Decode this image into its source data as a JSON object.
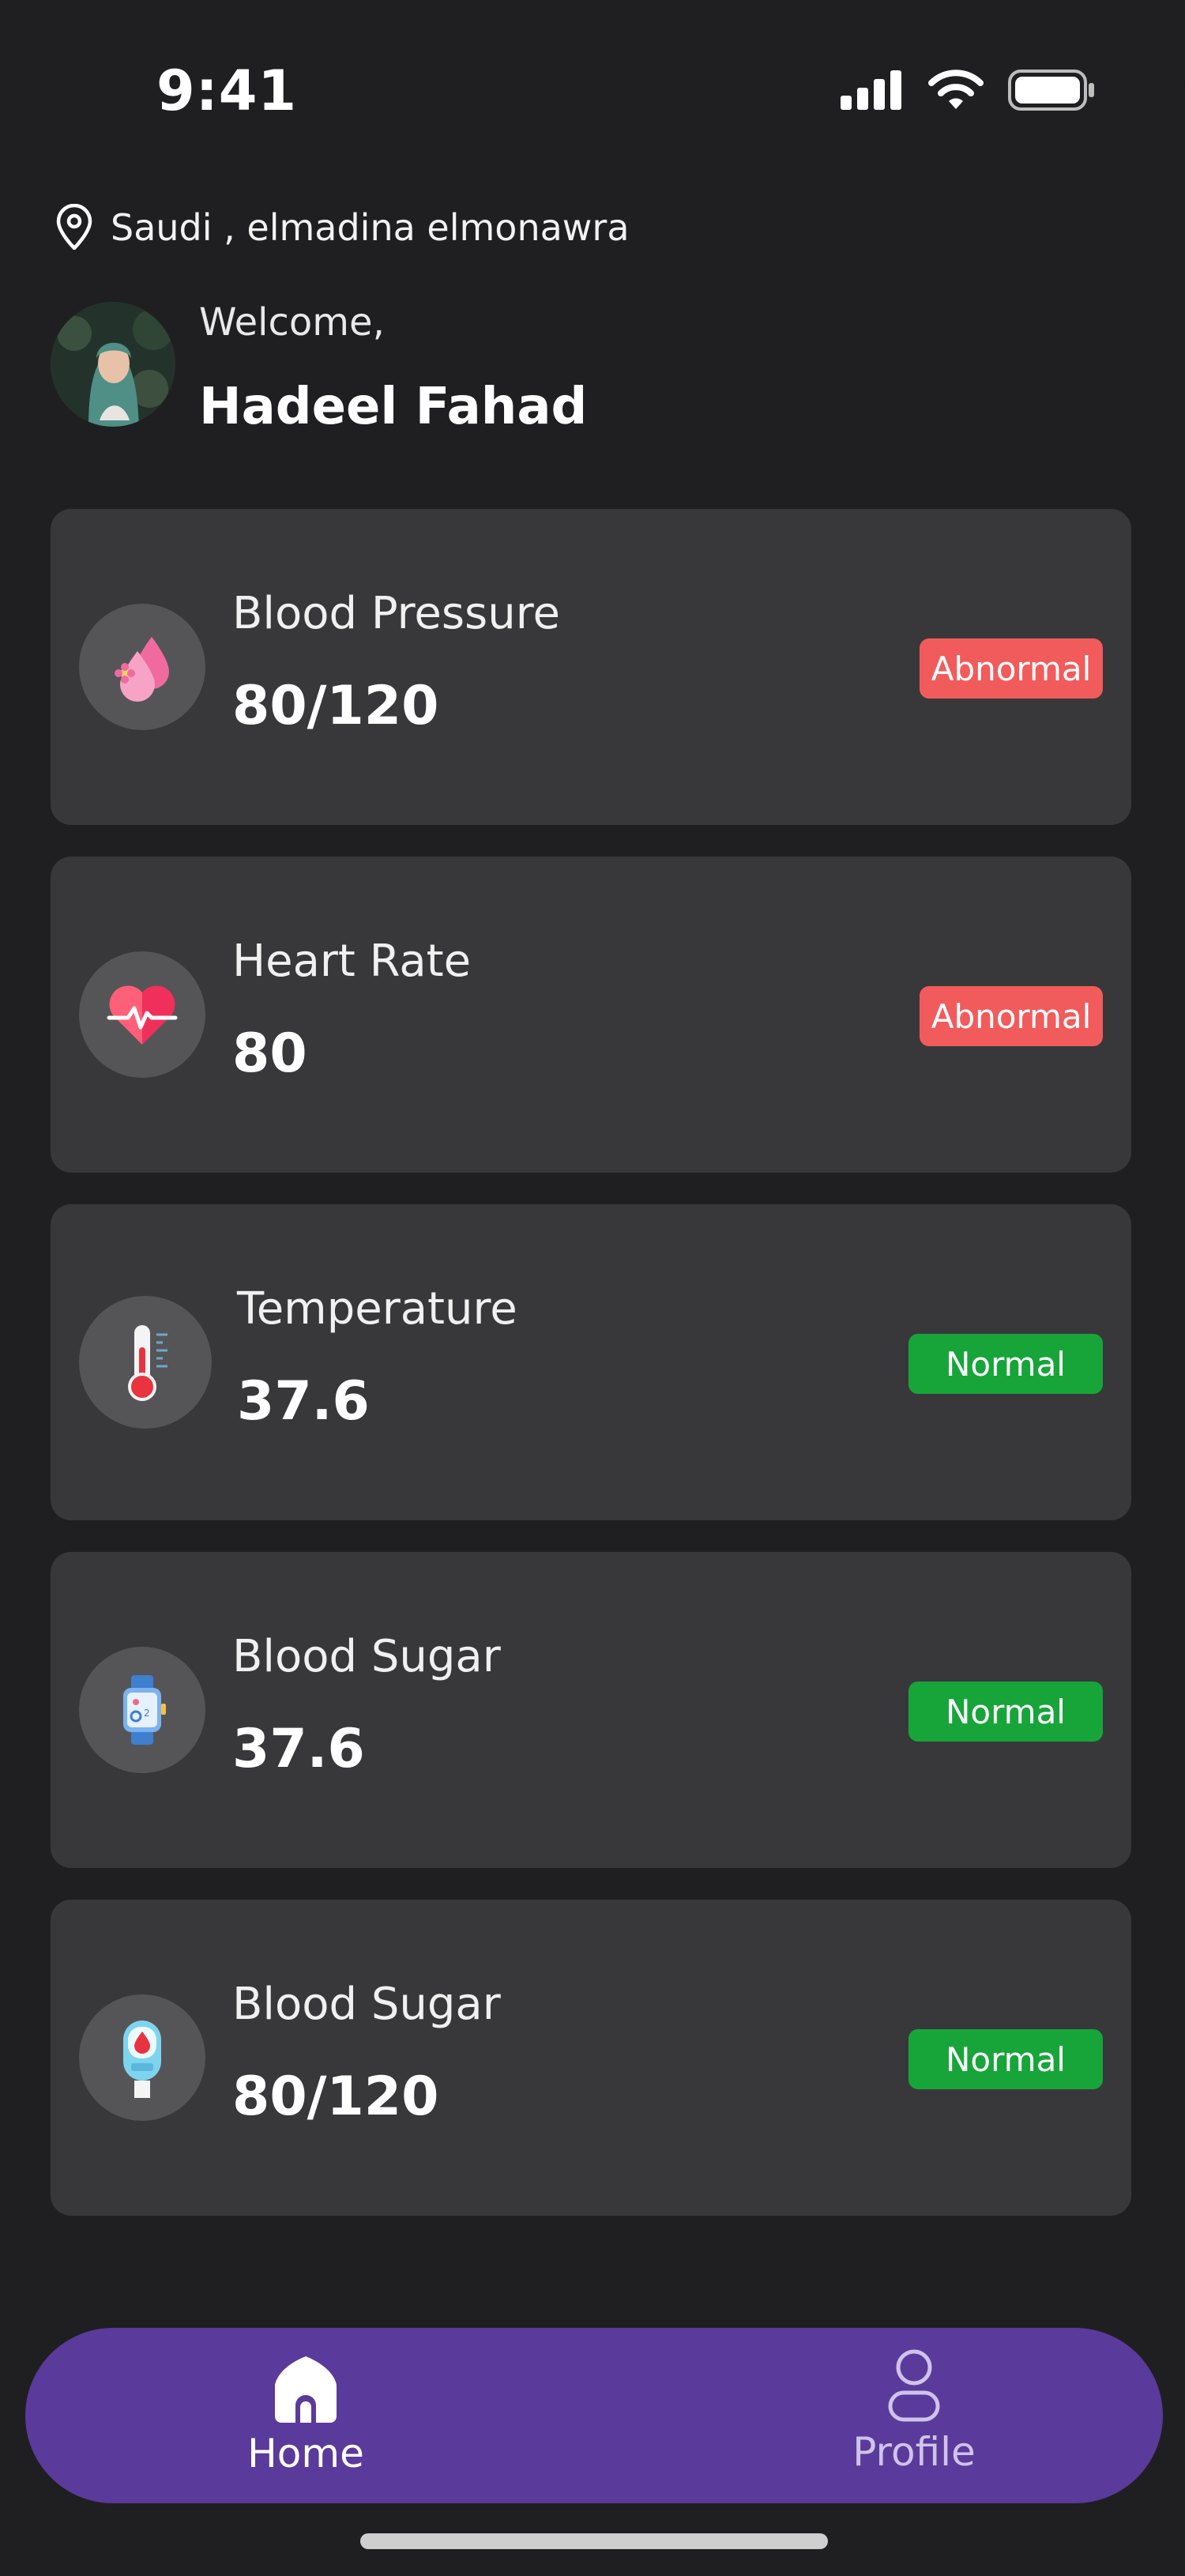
{
  "status_bar": {
    "time": "9:41"
  },
  "location": {
    "text": "Saudi , elmadina elmonawra"
  },
  "user": {
    "greeting": "Welcome,",
    "name": "Hadeel Fahad"
  },
  "cards": [
    {
      "label": "Blood Pressure",
      "value": "80/120",
      "status": "Abnormal",
      "icon": "blood-drops-icon"
    },
    {
      "label": "Heart Rate",
      "value": "80",
      "status": "Abnormal",
      "icon": "heart-pulse-icon"
    },
    {
      "label": "Temperature",
      "value": "37.6",
      "status": "Normal",
      "icon": "thermometer-icon"
    },
    {
      "label": "Blood Sugar",
      "value": "37.6",
      "status": "Normal",
      "icon": "smartwatch-icon"
    },
    {
      "label": "Blood Sugar",
      "value": "80/120",
      "status": "Normal",
      "icon": "glucose-meter-icon"
    }
  ],
  "nav": [
    {
      "label": "Home",
      "icon": "home-icon",
      "active": true
    },
    {
      "label": "Profile",
      "icon": "profile-icon",
      "active": false
    }
  ],
  "colors": {
    "background": "#1f1f21",
    "card": "#38383a",
    "abnormal": "#f25b5b",
    "normal": "#17a53a",
    "nav": "#5a3a9b"
  }
}
